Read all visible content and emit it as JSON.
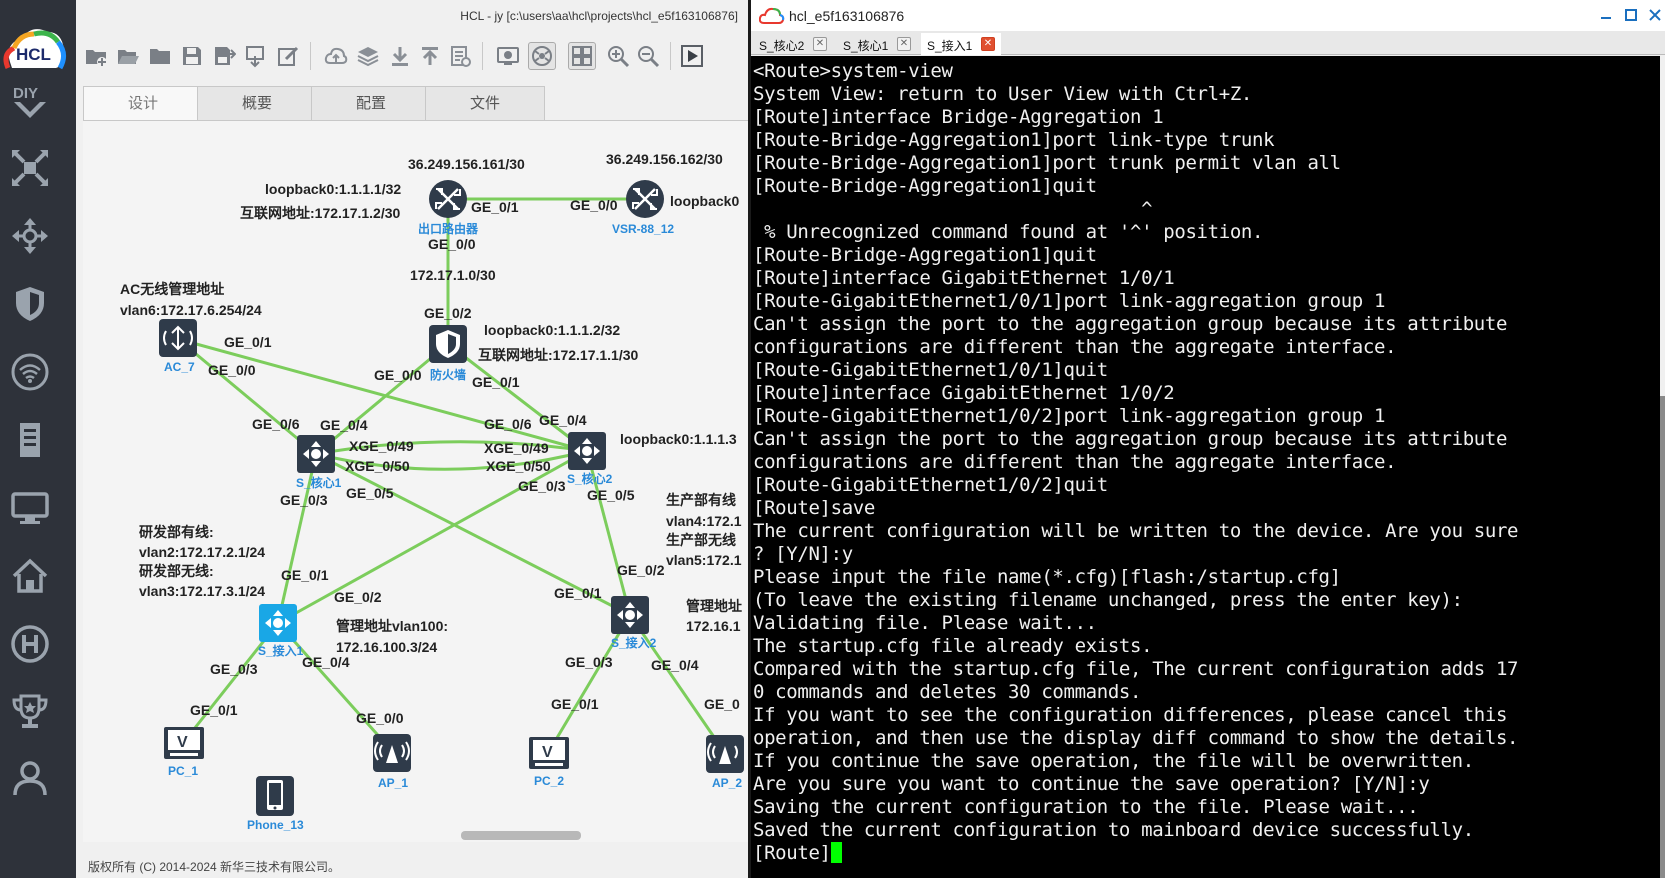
{
  "sidebar": {
    "logo_text": "HCL",
    "items": [
      {
        "icon": "diy-icon"
      },
      {
        "icon": "topology-icon"
      },
      {
        "icon": "move-icon"
      },
      {
        "icon": "shield-icon"
      },
      {
        "icon": "wifi-icon"
      },
      {
        "icon": "server-icon"
      },
      {
        "icon": "monitor-icon"
      },
      {
        "icon": "home-icon"
      },
      {
        "icon": "h3c-icon"
      },
      {
        "icon": "trophy-icon"
      },
      {
        "icon": "user-icon"
      }
    ]
  },
  "hcl_window": {
    "title": "HCL - jy [c:\\users\\aa\\hcl\\projects\\hcl_e5f163106876]",
    "tabs": [
      "设计",
      "概要",
      "配置",
      "文件"
    ],
    "active_tab": "设计",
    "status": "版权所有 (C) 2014-2024 新华三技术有限公司。"
  },
  "topology": {
    "labels": {
      "isp_ip1": "36.249.156.161/30",
      "isp_ip2": "36.249.156.162/30",
      "router_loopback": "loopback0:1.1.1.1/32",
      "router_inet": "互联网地址:172.17.1.2/30",
      "vsr_loopback": "loopback0",
      "link_172_17_1_0": "172.17.1.0/30",
      "ac_title": "AC无线管理地址",
      "ac_vlan": "vlan6:172.17.6.254/24",
      "fw_loopback": "loopback0:1.1.1.2/32",
      "fw_inet": "互联网地址:172.17.1.1/30",
      "core2_loopback": "loopback0:1.1.1.3",
      "rd_wired": "研发部有线:",
      "rd_vlan2": "vlan2:172.17.2.1/24",
      "rd_wireless": "研发部无线:",
      "rd_vlan3": "vlan3:172.17.3.1/24",
      "prod_wired": "生产部有线",
      "prod_vlan4": "vlan4:172.1",
      "prod_wireless": "生产部无线",
      "prod_vlan5": "vlan5:172.1",
      "mgmt_title": "管理地址vlan100:",
      "mgmt_ip": "172.16.100.3/24",
      "mgmt2_title": "管理地址",
      "mgmt2_ip": "172.16.1"
    },
    "devices": {
      "router": "出口路由器",
      "vsr": "VSR-88_12",
      "ac": "AC_7",
      "firewall": "防火墙",
      "core1": "S_核心1",
      "core2": "S_核心2",
      "access1": "S_接入1",
      "access2": "S_接入2",
      "pc1": "PC_1",
      "pc2": "PC_2",
      "ap1": "AP_1",
      "ap2": "AP_2",
      "phone": "Phone_13"
    },
    "ports": {
      "r_ge01": "GE_0/1",
      "vsr_ge00": "GE_0/0",
      "r_ge00": "GE_0/0",
      "fw_ge02": "GE_0/2",
      "ac_ge01": "GE_0/1",
      "ac_ge00": "GE_0/0",
      "fw_ge00": "GE_0/0",
      "fw_ge01": "GE_0/1",
      "c1_ge06": "GE_0/6",
      "c1_ge04": "GE_0/4",
      "c1_xge49": "XGE_0/49",
      "c1_xge50": "XGE_0/50",
      "c2_ge06": "GE_0/6",
      "c2_ge04": "GE_0/4",
      "c2_xge49": "XGE_0/49",
      "c2_xge50": "XGE_0/50",
      "c1_ge05": "GE_0/5",
      "c1_ge03": "GE_0/3",
      "c2_ge03": "GE_0/3",
      "c2_ge05": "GE_0/5",
      "a1_ge01": "GE_0/1",
      "a1_ge02": "GE_0/2",
      "a2_ge02": "GE_0/2",
      "a2_ge01": "GE_0/1",
      "a1_ge03": "GE_0/3",
      "a1_ge04": "GE_0/4",
      "a2_ge03": "GE_0/3",
      "a2_ge04": "GE_0/4",
      "pc1_ge01": "GE_0/1",
      "ap1_ge00": "GE_0/0",
      "pc2_ge01": "GE_0/1",
      "ap2_ge0": "GE_0"
    }
  },
  "terminal": {
    "title": "hcl_e5f163106876",
    "tabs": [
      "S_核心2",
      "S_核心1",
      "S_接入1"
    ],
    "active_tab": "S_接入1",
    "lines": [
      "<Route>system-view",
      "System View: return to User View with Ctrl+Z.",
      "[Route]interface Bridge-Aggregation 1",
      "[Route-Bridge-Aggregation1]port link-type trunk",
      "[Route-Bridge-Aggregation1]port trunk permit vlan all",
      "[Route-Bridge-Aggregation1]quit",
      "                                   ^",
      " % Unrecognized command found at '^' position.",
      "[Route-Bridge-Aggregation1]quit",
      "[Route]interface GigabitEthernet 1/0/1",
      "[Route-GigabitEthernet1/0/1]port link-aggregation group 1",
      "Can't assign the port to the aggregation group because its attribute",
      "configurations are different than the aggregate interface.",
      "[Route-GigabitEthernet1/0/1]quit",
      "[Route]interface GigabitEthernet 1/0/2",
      "[Route-GigabitEthernet1/0/2]port link-aggregation group 1",
      "Can't assign the port to the aggregation group because its attribute",
      "configurations are different than the aggregate interface.",
      "[Route-GigabitEthernet1/0/2]quit",
      "[Route]save",
      "The current configuration will be written to the device. Are you sure",
      "? [Y/N]:y",
      "Please input the file name(*.cfg)[flash:/startup.cfg]",
      "(To leave the existing filename unchanged, press the enter key):",
      "Validating file. Please wait...",
      "The startup.cfg file already exists.",
      "Compared with the startup.cfg file, The current configuration adds 17",
      "0 commands and deletes 30 commands.",
      "If you want to see the configuration differences, please cancel this",
      "operation, and then use the display diff command to show the details.",
      "If you continue the save operation, the file will be overwritten.",
      "Are you sure you want to continue the save operation? [Y/N]:y",
      "Saving the current configuration to the file. Please wait...",
      "Saved the current configuration to mainboard device successfully."
    ],
    "prompt": "[Route]"
  },
  "colors": {
    "sidebar_bg": "#2e323a",
    "link_green": "#7ccd5c",
    "device_dark": "#2f3b4a",
    "device_selected": "#19a7e6",
    "label_blue": "#2a8ad8",
    "cursor_green": "#00ff00",
    "tab_close_red": "#e05030"
  }
}
